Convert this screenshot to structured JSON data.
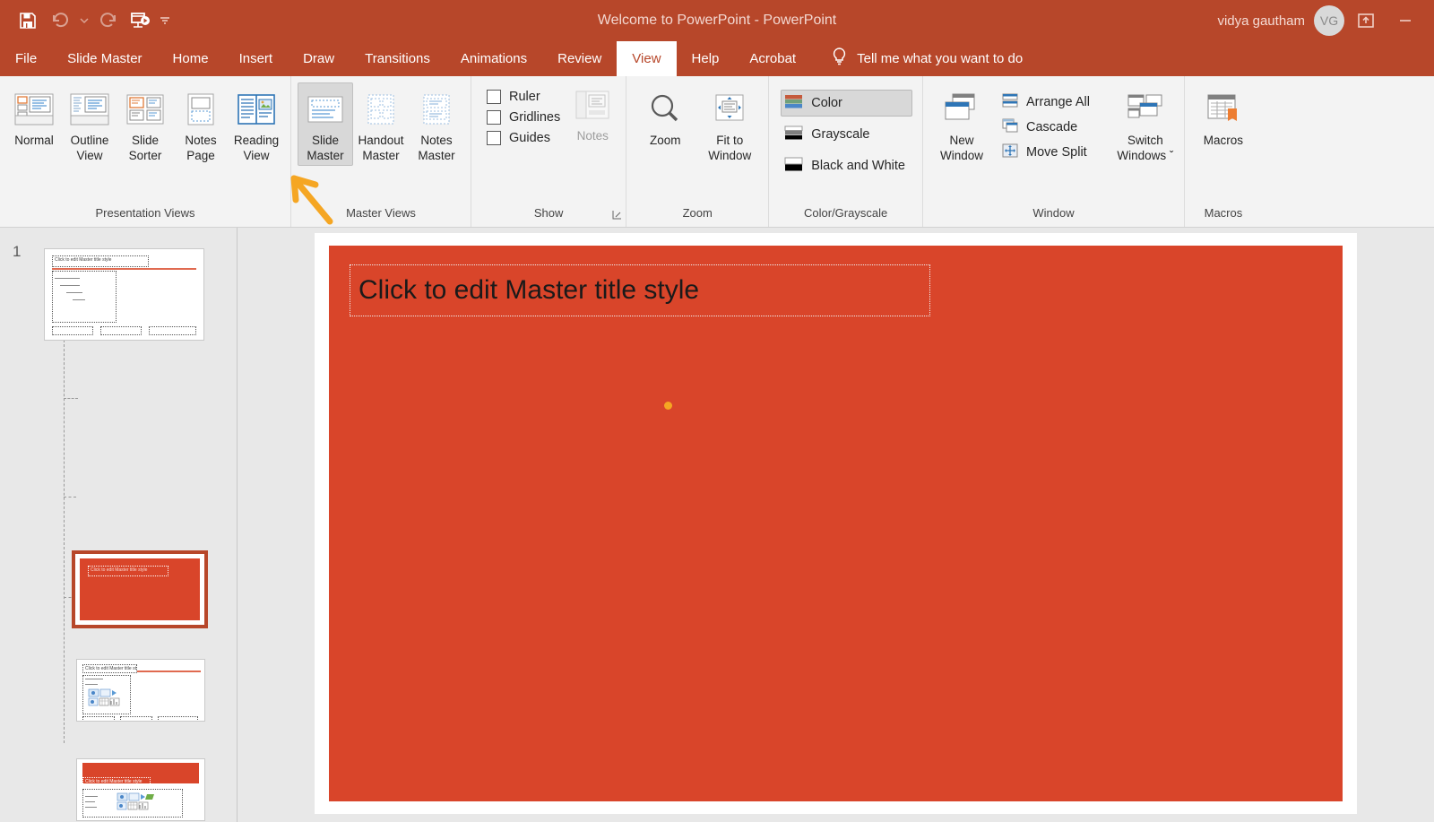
{
  "window": {
    "title": "Welcome to PowerPoint  -  PowerPoint",
    "user_name": "vidya gautham",
    "avatar_initials": "VG",
    "titlebar_color": "#b7472a",
    "minimize_label": "—"
  },
  "quick_access": [
    {
      "name": "save-icon",
      "label": "Save"
    },
    {
      "name": "undo-icon",
      "label": "Undo"
    },
    {
      "name": "undo-dropdown-caret-icon",
      "label": "Undo options"
    },
    {
      "name": "redo-icon",
      "label": "Redo"
    },
    {
      "name": "start-presentation-icon",
      "label": "Start From Beginning"
    },
    {
      "name": "customize-qat-caret-icon",
      "label": "Customize Quick Access Toolbar"
    }
  ],
  "titlebar_right_icons": [
    {
      "name": "ribbon-display-options-icon",
      "label": "Ribbon Display Options"
    },
    {
      "name": "minimize-icon",
      "label": "Minimize"
    }
  ],
  "tabs": [
    {
      "label": "File",
      "active": false
    },
    {
      "label": "Slide Master",
      "active": false
    },
    {
      "label": "Home",
      "active": false
    },
    {
      "label": "Insert",
      "active": false
    },
    {
      "label": "Draw",
      "active": false
    },
    {
      "label": "Transitions",
      "active": false
    },
    {
      "label": "Animations",
      "active": false
    },
    {
      "label": "Review",
      "active": false
    },
    {
      "label": "View",
      "active": true
    },
    {
      "label": "Help",
      "active": false
    },
    {
      "label": "Acrobat",
      "active": false
    }
  ],
  "tell_me": {
    "icon": "lightbulb-icon",
    "text": "Tell me what you want to do"
  },
  "ribbon": {
    "groups": [
      {
        "label": "Presentation Views",
        "buttons": [
          {
            "label_line1": "Normal",
            "label_line2": "",
            "icon": "normal-view-icon",
            "selected": false
          },
          {
            "label_line1": "Outline",
            "label_line2": "View",
            "icon": "outline-view-icon",
            "selected": false
          },
          {
            "label_line1": "Slide",
            "label_line2": "Sorter",
            "icon": "slide-sorter-icon",
            "selected": false
          },
          {
            "label_line1": "Notes",
            "label_line2": "Page",
            "icon": "notes-page-icon",
            "selected": false
          },
          {
            "label_line1": "Reading",
            "label_line2": "View",
            "icon": "reading-view-icon",
            "selected": false
          }
        ]
      },
      {
        "label": "Master Views",
        "buttons": [
          {
            "label_line1": "Slide",
            "label_line2": "Master",
            "icon": "slide-master-icon",
            "selected": true
          },
          {
            "label_line1": "Handout",
            "label_line2": "Master",
            "icon": "handout-master-icon",
            "selected": false
          },
          {
            "label_line1": "Notes",
            "label_line2": "Master",
            "icon": "notes-master-icon",
            "selected": false
          }
        ]
      },
      {
        "label": "Show",
        "checkboxes": [
          {
            "label": "Ruler",
            "checked": false
          },
          {
            "label": "Gridlines",
            "checked": false
          },
          {
            "label": "Guides",
            "checked": false
          }
        ],
        "notes_button": {
          "label": "Notes",
          "icon": "notes-icon",
          "disabled": true
        },
        "dialog_launcher": "show-dialog-launcher-icon"
      },
      {
        "label": "Zoom",
        "buttons": [
          {
            "label_line1": "Zoom",
            "label_line2": "",
            "icon": "zoom-magnifier-icon",
            "selected": false
          },
          {
            "label_line1": "Fit to",
            "label_line2": "Window",
            "icon": "fit-to-window-icon",
            "selected": false
          }
        ]
      },
      {
        "label": "Color/Grayscale",
        "options": [
          {
            "label": "Color",
            "selected": true,
            "icon": "color-swatch-icon"
          },
          {
            "label": "Grayscale",
            "selected": false,
            "icon": "grayscale-swatch-icon"
          },
          {
            "label": "Black and White",
            "selected": false,
            "icon": "black-and-white-swatch-icon"
          }
        ]
      },
      {
        "label": "Window",
        "buttons": [
          {
            "label_line1": "New",
            "label_line2": "Window",
            "icon": "new-window-icon",
            "selected": false
          },
          {
            "label_line1": "Switch",
            "label_line2": "Windows ˇ",
            "icon": "switch-windows-icon",
            "selected": false
          }
        ],
        "small_commands": [
          {
            "label": "Arrange All",
            "icon": "arrange-all-icon"
          },
          {
            "label": "Cascade",
            "icon": "cascade-icon"
          },
          {
            "label": "Move Split",
            "icon": "move-split-icon"
          }
        ]
      },
      {
        "label": "Macros",
        "buttons": [
          {
            "label_line1": "Macros",
            "label_line2": "",
            "icon": "macros-icon",
            "selected": false
          }
        ]
      }
    ]
  },
  "thumbnail_pane": {
    "slide_number": "1",
    "thumbnails": [
      {
        "name": "slide-master-thumbnail",
        "type": "master",
        "selected": false,
        "title_text": "Click to edit Master title style"
      },
      {
        "name": "title-slide-layout-thumbnail",
        "type": "orange-title",
        "selected": true,
        "title_text": "Click to edit Master title style"
      },
      {
        "name": "content-layout-thumbnail",
        "type": "content",
        "selected": false,
        "title_text": "Click to edit Master title style"
      },
      {
        "name": "banner-layout-thumbnail",
        "type": "banner",
        "selected": false,
        "title_text": "Click to edit Master title style"
      }
    ]
  },
  "slide_canvas": {
    "background_color": "#d9452a",
    "title_placeholder_text": "Click to edit Master title style",
    "marker_color": "#f5a623"
  },
  "annotation": {
    "arrow_color": "#f5a623",
    "points_to": "slide-master-button"
  }
}
